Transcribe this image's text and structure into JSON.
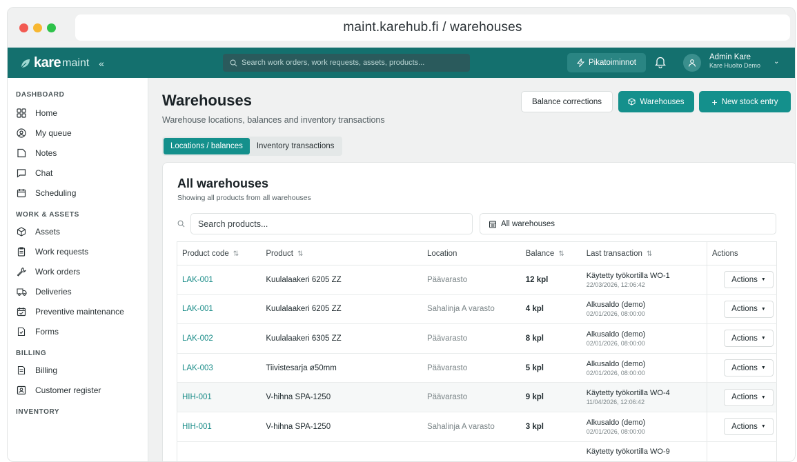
{
  "browser": {
    "url": "maint.karehub.fi / warehouses"
  },
  "appbar": {
    "brand_kare": "kare",
    "brand_maint": "maint",
    "collapse": "«",
    "search_placeholder": "Search work orders, work requests, assets, products...",
    "quick_actions": "Pikatoiminnot",
    "user_name": "Admin Kare",
    "user_org": "Kare Huolto Demo"
  },
  "sidebar": {
    "sections": [
      {
        "title": "DASHBOARD",
        "items": [
          {
            "label": "Home",
            "icon": "grid-icon"
          },
          {
            "label": "My queue",
            "icon": "user-circle-icon"
          },
          {
            "label": "Notes",
            "icon": "note-icon"
          },
          {
            "label": "Chat",
            "icon": "chat-icon"
          },
          {
            "label": "Scheduling",
            "icon": "calendar-icon"
          }
        ]
      },
      {
        "title": "WORK & ASSETS",
        "items": [
          {
            "label": "Assets",
            "icon": "cube-icon"
          },
          {
            "label": "Work requests",
            "icon": "clipboard-icon"
          },
          {
            "label": "Work orders",
            "icon": "wrench-icon"
          },
          {
            "label": "Deliveries",
            "icon": "truck-icon"
          },
          {
            "label": "Preventive maintenance",
            "icon": "calendar-check-icon"
          },
          {
            "label": "Forms",
            "icon": "form-icon"
          }
        ]
      },
      {
        "title": "BILLING",
        "items": [
          {
            "label": "Billing",
            "icon": "document-icon"
          },
          {
            "label": "Customer register",
            "icon": "contact-icon"
          }
        ]
      },
      {
        "title": "INVENTORY",
        "items": []
      }
    ]
  },
  "page": {
    "title": "Warehouses",
    "subtitle": "Warehouse locations, balances and inventory transactions",
    "btn_balance": "Balance corrections",
    "btn_warehouses": "Warehouses",
    "btn_new": "New stock entry",
    "tabs": [
      "Locations / balances",
      "Inventory transactions"
    ]
  },
  "card": {
    "title": "All warehouses",
    "subtitle": "Showing all products from all warehouses",
    "search_placeholder": "Search products...",
    "warehouse_filter": "All warehouses",
    "columns": [
      "Product code",
      "Product",
      "Location",
      "Balance",
      "Last transaction",
      "Actions"
    ],
    "rows": [
      {
        "code": "LAK-001",
        "product": "Kuulalaakeri 6205 ZZ",
        "location": "Päävarasto",
        "balance": "12 kpl",
        "tx": "Käytetty työkortilla WO-1",
        "tx_date": "22/03/2026, 12:06:42",
        "action": "Actions"
      },
      {
        "code": "LAK-001",
        "product": "Kuulalaakeri 6205 ZZ",
        "location": "Sahalinja A varasto",
        "balance": "4 kpl",
        "tx": "Alkusaldo (demo)",
        "tx_date": "02/01/2026, 08:00:00",
        "action": "Actions"
      },
      {
        "code": "LAK-002",
        "product": "Kuulalaakeri 6305 ZZ",
        "location": "Päävarasto",
        "balance": "8 kpl",
        "tx": "Alkusaldo (demo)",
        "tx_date": "02/01/2026, 08:00:00",
        "action": "Actions"
      },
      {
        "code": "LAK-003",
        "product": "Tiivistesarja ø50mm",
        "location": "Päävarasto",
        "balance": "5 kpl",
        "tx": "Alkusaldo (demo)",
        "tx_date": "02/01/2026, 08:00:00",
        "action": "Actions"
      },
      {
        "code": "HIH-001",
        "product": "V-hihna SPA-1250",
        "location": "Päävarasto",
        "balance": "9 kpl",
        "tx": "Käytetty työkortilla WO-4",
        "tx_date": "11/04/2026, 12:06:42",
        "action": "Actions"
      },
      {
        "code": "HIH-001",
        "product": "V-hihna SPA-1250",
        "location": "Sahalinja A varasto",
        "balance": "3 kpl",
        "tx": "Alkusaldo (demo)",
        "tx_date": "02/01/2026, 08:00:00",
        "action": "Actions"
      },
      {
        "code": "",
        "product": "",
        "location": "",
        "balance": "",
        "tx": "Käytetty työkortilla WO-9",
        "tx_date": "",
        "action": ""
      }
    ]
  },
  "colors": {
    "brand": "#14706e",
    "accent": "#14908c",
    "link": "#168a86"
  }
}
